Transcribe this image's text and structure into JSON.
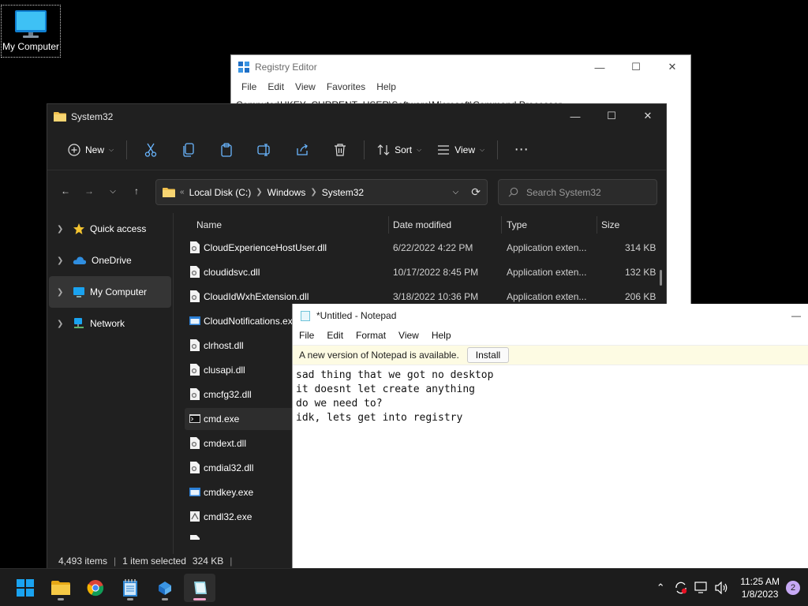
{
  "desktop": {
    "icon_label": "My Computer"
  },
  "regedit": {
    "title": "Registry Editor",
    "menu": [
      "File",
      "Edit",
      "View",
      "Favorites",
      "Help"
    ],
    "address": "Computer\\HKEY_CURRENT_USER\\Software\\Microsoft\\Command Processor"
  },
  "explorer": {
    "title": "System32",
    "toolbar": {
      "new_label": "New",
      "sort_label": "Sort",
      "view_label": "View"
    },
    "breadcrumb": [
      "Local Disk (C:)",
      "Windows",
      "System32"
    ],
    "search_placeholder": "Search System32",
    "sidebar": [
      "Quick access",
      "OneDrive",
      "My Computer",
      "Network"
    ],
    "columns": [
      "Name",
      "Date modified",
      "Type",
      "Size"
    ],
    "files": [
      {
        "name": "CloudExperienceHostUser.dll",
        "date": "6/22/2022 4:22 PM",
        "type": "Application exten...",
        "size": "314 KB"
      },
      {
        "name": "cloudidsvc.dll",
        "date": "10/17/2022 8:45 PM",
        "type": "Application exten...",
        "size": "132 KB"
      },
      {
        "name": "CloudIdWxhExtension.dll",
        "date": "3/18/2022 10:36 PM",
        "type": "Application exten...",
        "size": "206 KB"
      },
      {
        "name": "CloudNotifications.exe",
        "date": "",
        "type": "",
        "size": ""
      },
      {
        "name": "clrhost.dll",
        "date": "",
        "type": "",
        "size": ""
      },
      {
        "name": "clusapi.dll",
        "date": "",
        "type": "",
        "size": ""
      },
      {
        "name": "cmcfg32.dll",
        "date": "",
        "type": "",
        "size": ""
      },
      {
        "name": "cmd.exe",
        "date": "",
        "type": "",
        "size": ""
      },
      {
        "name": "cmdext.dll",
        "date": "",
        "type": "",
        "size": ""
      },
      {
        "name": "cmdial32.dll",
        "date": "",
        "type": "",
        "size": ""
      },
      {
        "name": "cmdkey.exe",
        "date": "",
        "type": "",
        "size": ""
      },
      {
        "name": "cmdl32.exe",
        "date": "",
        "type": "",
        "size": ""
      }
    ],
    "status": {
      "items": "4,493 items",
      "selected": "1 item selected",
      "size": "324 KB"
    }
  },
  "notepad": {
    "title": "*Untitled - Notepad",
    "menu": [
      "File",
      "Edit",
      "Format",
      "View",
      "Help"
    ],
    "banner_text": "A new version of Notepad is available.",
    "install_label": "Install",
    "content": "sad thing that we got no desktop\nit doesnt let create anything\ndo we need to?\nidk, lets get into registry"
  },
  "taskbar": {
    "time": "11:25 AM",
    "date": "1/8/2023",
    "notification_count": "2"
  },
  "colors": {
    "explorer_bg": "#202020",
    "folder_yellow": "#f2c14e",
    "windows_blue": "#1aa3f0"
  }
}
